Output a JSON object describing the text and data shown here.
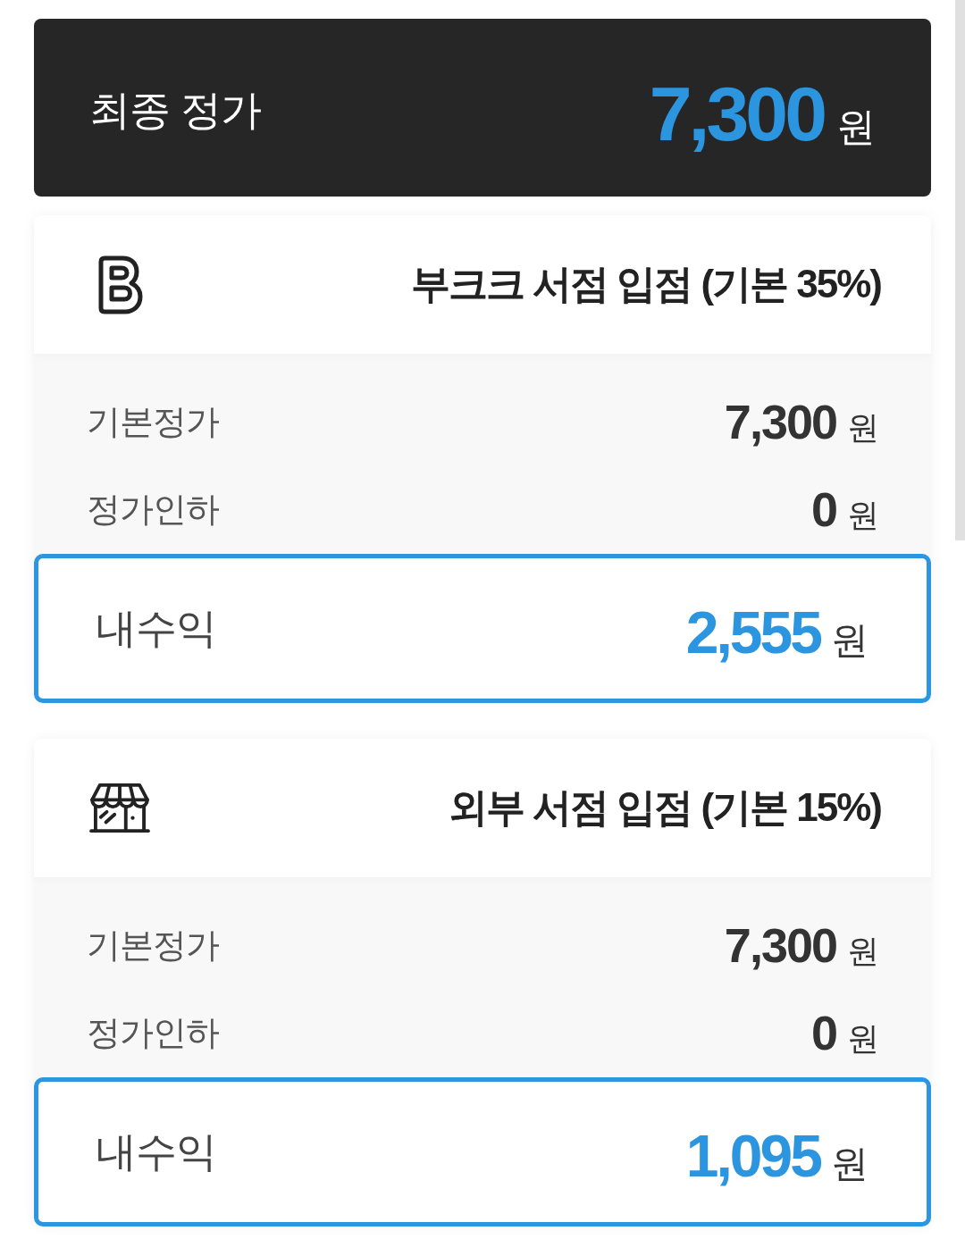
{
  "final_price": {
    "label": "최종 정가",
    "amount": "7,300",
    "unit": "원"
  },
  "channels": [
    {
      "kind": "bookk",
      "title": "부크크 서점 입점 (기본 35%)",
      "rows": [
        {
          "label": "기본정가",
          "amount": "7,300",
          "unit": "원"
        },
        {
          "label": "정가인하",
          "amount": "0",
          "unit": "원"
        }
      ],
      "earnings": {
        "label": "내수익",
        "amount": "2,555",
        "unit": "원"
      }
    },
    {
      "kind": "store",
      "title": "외부 서점 입점 (기본 15%)",
      "rows": [
        {
          "label": "기본정가",
          "amount": "7,300",
          "unit": "원"
        },
        {
          "label": "정가인하",
          "amount": "0",
          "unit": "원"
        }
      ],
      "earnings": {
        "label": "내수익",
        "amount": "1,095",
        "unit": "원"
      }
    }
  ]
}
